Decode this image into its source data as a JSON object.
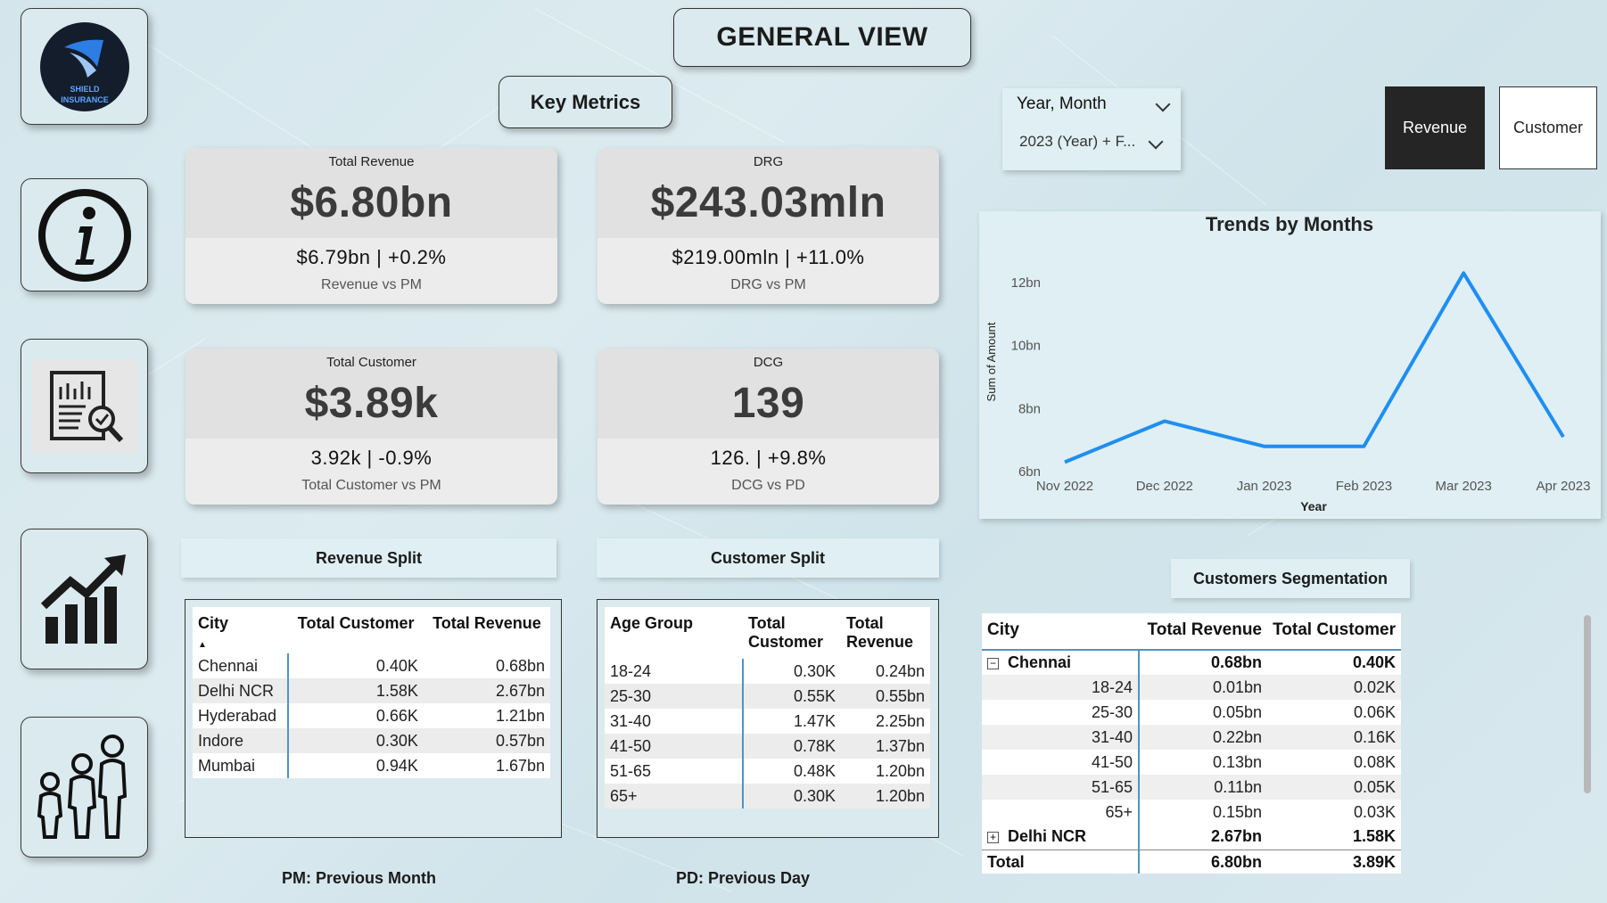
{
  "header": {
    "title": "GENERAL VIEW",
    "subtitle": "Key Metrics"
  },
  "nav": {
    "logo_text_line1": "SHIELD",
    "logo_text_line2": "INSURANCE"
  },
  "kpis": {
    "revenue": {
      "label": "Total Revenue",
      "value": "$6.80bn",
      "sub": "$6.79bn | +0.2%",
      "caption": "Revenue vs PM"
    },
    "drg": {
      "label": "DRG",
      "value": "$243.03mln",
      "sub": "$219.00mln | +11.0%",
      "caption": "DRG vs PM"
    },
    "customer": {
      "label": "Total Customer",
      "value": "$3.89k",
      "sub": "3.92k | -0.9%",
      "caption": "Total Customer vs PM"
    },
    "dcg": {
      "label": "DCG",
      "value": "139",
      "sub": "126. | +9.8%",
      "caption": "DCG vs PD"
    }
  },
  "slicer": {
    "title": "Year, Month",
    "value": "2023 (Year) + F..."
  },
  "toggles": {
    "revenue": "Revenue",
    "customer": "Customer"
  },
  "revenue_split": {
    "title": "Revenue Split",
    "headers": [
      "City",
      "Total Customer",
      "Total Revenue"
    ],
    "rows": [
      [
        "Chennai",
        "0.40K",
        "0.68bn"
      ],
      [
        "Delhi NCR",
        "1.58K",
        "2.67bn"
      ],
      [
        "Hyderabad",
        "0.66K",
        "1.21bn"
      ],
      [
        "Indore",
        "0.30K",
        "0.57bn"
      ],
      [
        "Mumbai",
        "0.94K",
        "1.67bn"
      ]
    ]
  },
  "customer_split": {
    "title": "Customer Split",
    "headers": [
      "Age Group",
      "Total Customer",
      "Total Revenue"
    ],
    "rows": [
      [
        "18-24",
        "0.30K",
        "0.24bn"
      ],
      [
        "25-30",
        "0.55K",
        "0.55bn"
      ],
      [
        "31-40",
        "1.47K",
        "2.25bn"
      ],
      [
        "41-50",
        "0.78K",
        "1.37bn"
      ],
      [
        "51-65",
        "0.48K",
        "1.20bn"
      ],
      [
        "65+",
        "0.30K",
        "1.20bn"
      ]
    ]
  },
  "segmentation": {
    "title": "Customers Segmentation",
    "headers": [
      "City",
      "Total Revenue",
      "Total Customer"
    ],
    "groups": [
      {
        "city": "Chennai",
        "revenue": "0.68bn",
        "customer": "0.40K",
        "expanded": true,
        "rows": [
          [
            "18-24",
            "0.01bn",
            "0.02K"
          ],
          [
            "25-30",
            "0.05bn",
            "0.06K"
          ],
          [
            "31-40",
            "0.22bn",
            "0.16K"
          ],
          [
            "41-50",
            "0.13bn",
            "0.08K"
          ],
          [
            "51-65",
            "0.11bn",
            "0.05K"
          ],
          [
            "65+",
            "0.15bn",
            "0.03K"
          ]
        ]
      },
      {
        "city": "Delhi NCR",
        "revenue": "2.67bn",
        "customer": "1.58K",
        "expanded": false,
        "rows": []
      }
    ],
    "total": [
      "Total",
      "6.80bn",
      "3.89K"
    ]
  },
  "footnotes": {
    "pm": "PM: Previous Month",
    "pd": "PD: Previous Day"
  },
  "chart_data": {
    "type": "line",
    "title": "Trends by Months",
    "xlabel": "Year",
    "ylabel": "Sum of Amount",
    "categories": [
      "Nov 2022",
      "Dec 2022",
      "Jan 2023",
      "Feb 2023",
      "Mar 2023",
      "Apr 2023"
    ],
    "series": [
      {
        "values": [
          6.3,
          7.6,
          6.8,
          6.8,
          12.3,
          7.1
        ]
      }
    ],
    "yticks": [
      "6bn",
      "8bn",
      "10bn",
      "12bn"
    ],
    "ytick_values": [
      6,
      8,
      10,
      12
    ],
    "ylim": [
      6,
      12
    ],
    "grid": false,
    "color": "#1f8ef1"
  }
}
